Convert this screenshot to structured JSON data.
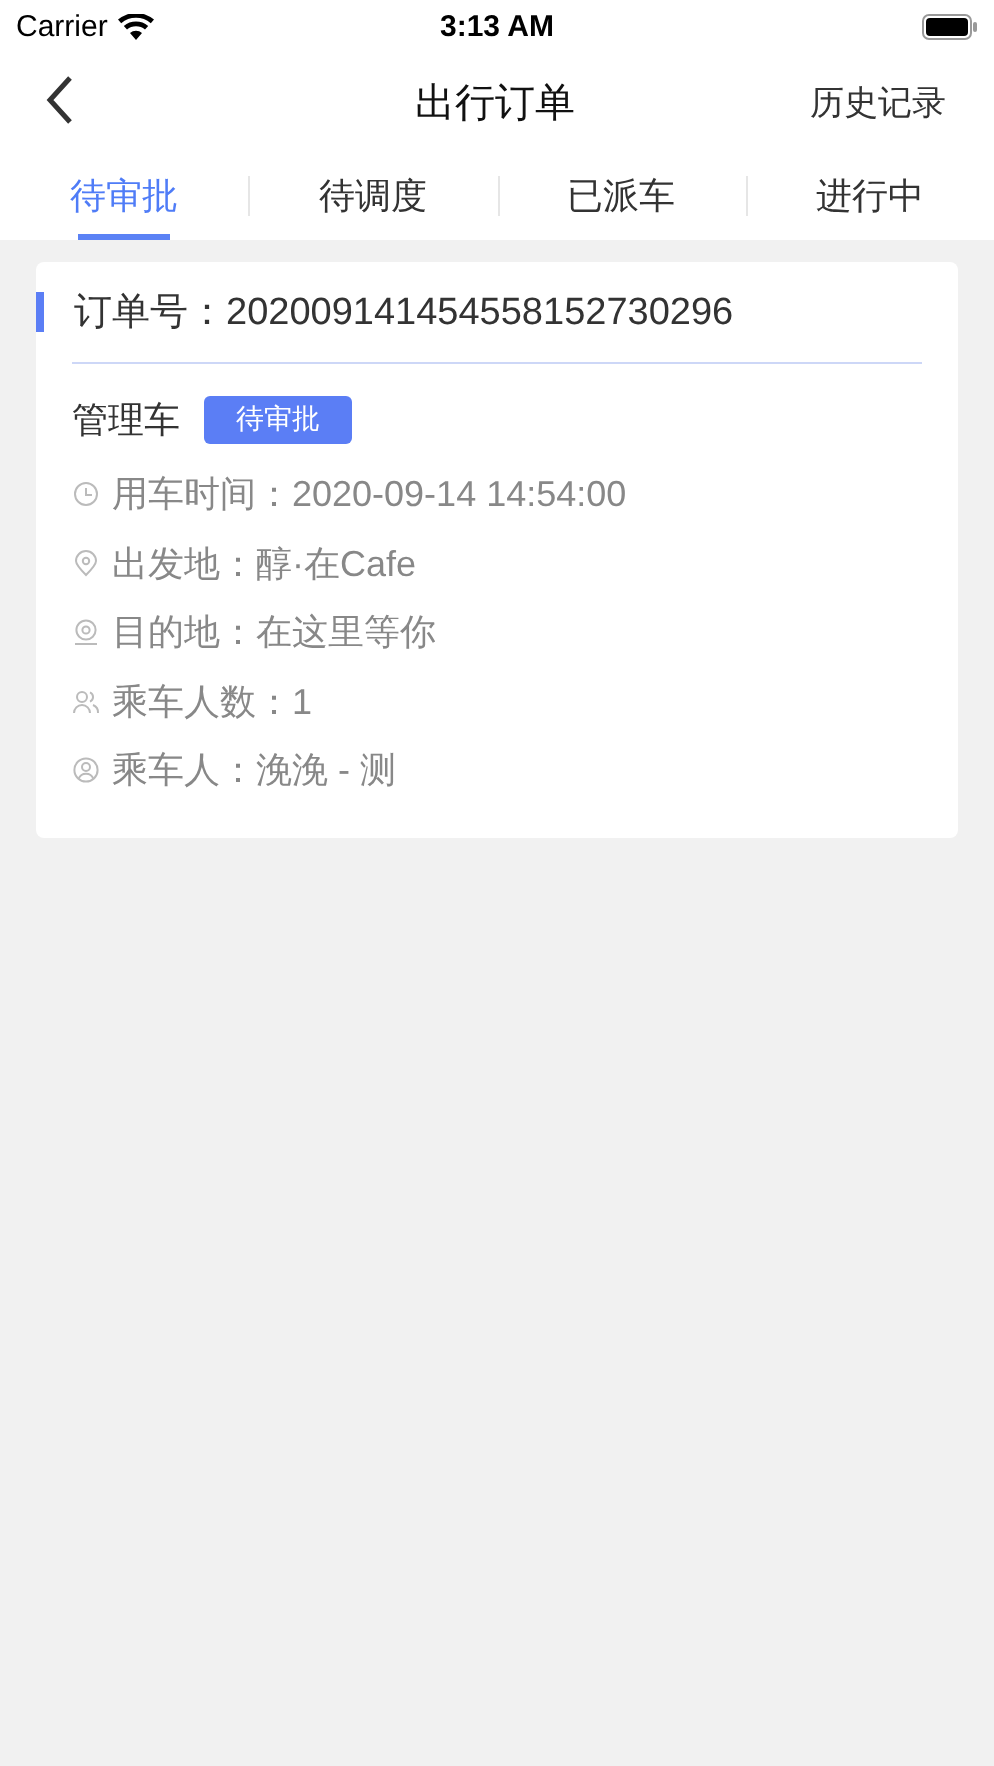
{
  "status_bar": {
    "carrier": "Carrier",
    "time": "3:13 AM"
  },
  "nav": {
    "title": "出行订单",
    "action": "历史记录"
  },
  "tabs": [
    {
      "label": "待审批",
      "selected": true
    },
    {
      "label": "待调度",
      "selected": false
    },
    {
      "label": "已派车",
      "selected": false
    },
    {
      "label": "进行中",
      "selected": false
    }
  ],
  "orders": [
    {
      "order_no": "订单号：202009141454558152730296",
      "vehicle": "管理车",
      "status": "待审批",
      "details": [
        {
          "kind": "time",
          "text": "用车时间：2020-09-14 14:54:00"
        },
        {
          "kind": "origin",
          "text": "出发地：醇·在Cafe"
        },
        {
          "kind": "destination",
          "text": "目的地：在这里等你"
        },
        {
          "kind": "count",
          "text": "乘车人数：1"
        },
        {
          "kind": "passenger",
          "text": "乘车人：浼浼 - 测"
        }
      ]
    }
  ]
}
